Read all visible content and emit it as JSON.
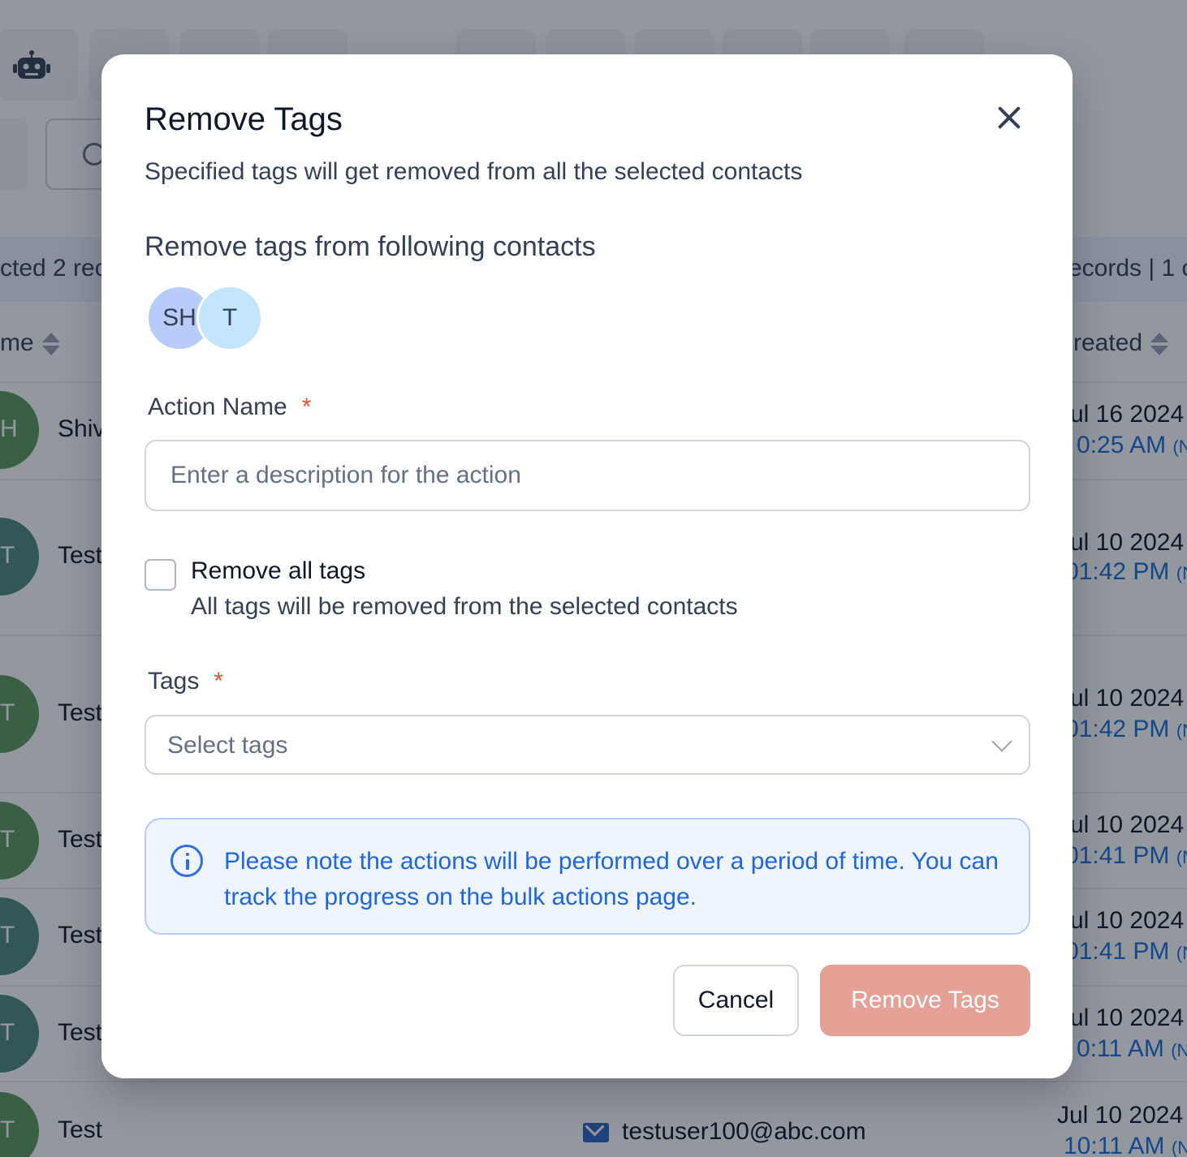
{
  "background": {
    "selection_left": "cted 2 rec",
    "selection_right": "ecords | 1 c",
    "column_left": "me",
    "column_right": "reated",
    "rows": [
      {
        "initials": "H",
        "name": "Shiv",
        "date": "ul 16 2024",
        "time": "0:25 AM",
        "tz": "(N"
      },
      {
        "initials": "T",
        "name": "Test",
        "date": "ul 10 2024",
        "time": "01:42 PM",
        "tz": "(N"
      },
      {
        "initials": "T",
        "name": "Test",
        "date": "ul 10 2024",
        "time": "01:42 PM",
        "tz": "(N"
      },
      {
        "initials": "T",
        "name": "Test",
        "date": "ul 10 2024",
        "time": "01:41 PM",
        "tz": "(N"
      },
      {
        "initials": "T",
        "name": "Test",
        "date": "ul 10 2024",
        "time": "01:41 PM",
        "tz": "(N"
      },
      {
        "initials": "T",
        "name": "Test",
        "date": "ul 10 2024",
        "time": "0:11 AM",
        "tz": "(N"
      },
      {
        "initials": "T",
        "name": "Test",
        "date": "Jul 10 2024",
        "time": "10:11 AM",
        "tz": "(N",
        "email": "testuser100@abc.com"
      }
    ]
  },
  "modal": {
    "title": "Remove Tags",
    "subtitle": "Specified tags will get removed from all the selected contacts",
    "section_title": "Remove tags from following contacts",
    "contacts": [
      {
        "initials": "SH",
        "color": "#b8ccf9"
      },
      {
        "initials": "T",
        "color": "#c4e6fc"
      }
    ],
    "action_name": {
      "label": "Action Name",
      "required_mark": "*",
      "value": "",
      "placeholder": "Enter a description for the action"
    },
    "remove_all": {
      "checked": false,
      "title": "Remove all tags",
      "description": "All tags will be removed from the selected contacts"
    },
    "tags": {
      "label": "Tags",
      "required_mark": "*",
      "placeholder": "Select tags"
    },
    "note": "Please note the actions will be performed over a period of time. You can track the progress on the bulk actions page.",
    "buttons": {
      "cancel": "Cancel",
      "submit": "Remove Tags"
    }
  },
  "colors": {
    "accent_blue": "#1f66e0",
    "submit_disabled": "#e5a196",
    "required": "#e04f3c",
    "note_bg": "#eff5ff"
  },
  "icons": {
    "close": "close-icon",
    "info": "info-icon",
    "dropdown": "chevron-down-icon",
    "toolbar_first": "robot-icon"
  }
}
